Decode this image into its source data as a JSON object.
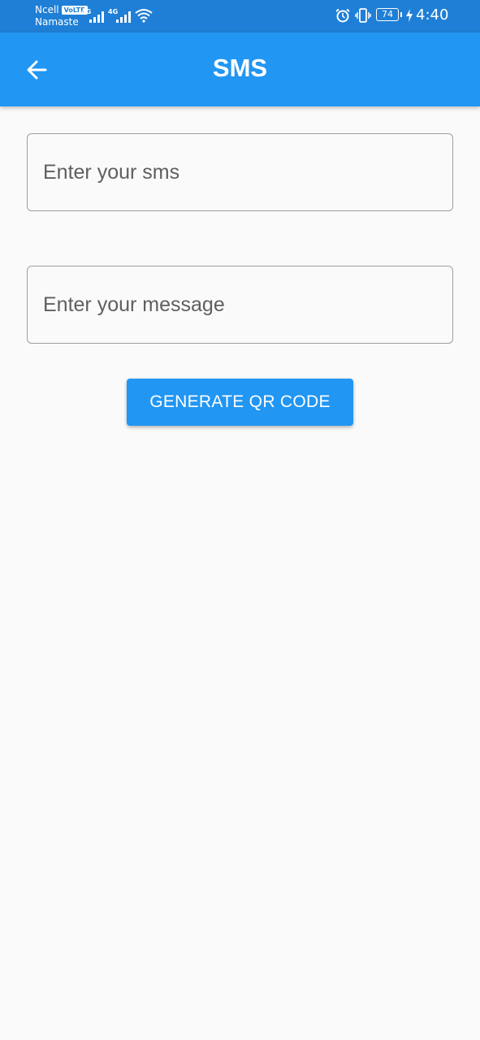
{
  "status_bar": {
    "carrier_1": "Ncell",
    "volte": "VoLTE",
    "carrier_2": "Namaste",
    "network_1": "4G",
    "network_2": "4G",
    "battery_level": "74",
    "time": "4:40"
  },
  "app_bar": {
    "title": "SMS",
    "back_icon": "arrow-left-icon"
  },
  "form": {
    "sms_placeholder": "Enter your sms",
    "sms_value": "",
    "message_placeholder": "Enter your message",
    "message_value": "",
    "generate_label": "GENERATE QR CODE"
  },
  "colors": {
    "status_bar": "#1f7fd6",
    "primary": "#2196f3",
    "background": "#fafafa",
    "field_border": "#9e9e9e"
  }
}
